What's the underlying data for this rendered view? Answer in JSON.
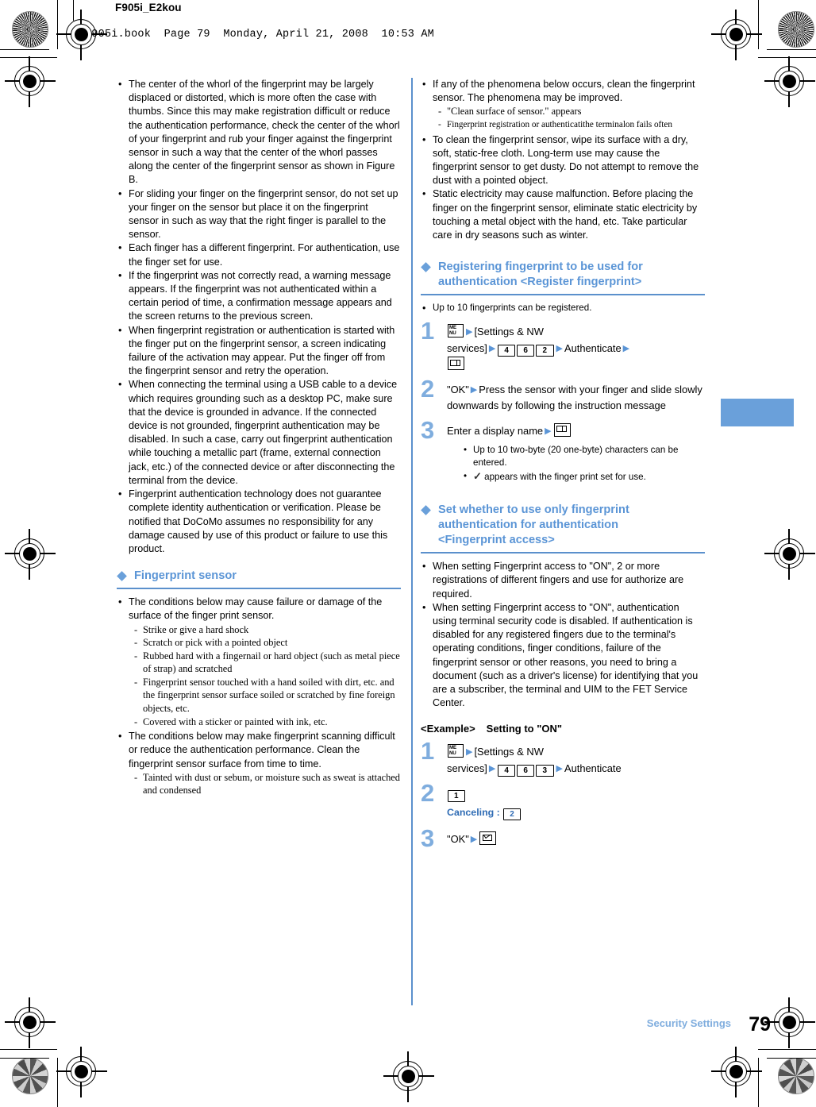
{
  "header": {
    "doc_code": "F905i_E2kou",
    "book_line": "F905i.book  Page 79  Monday, April 21, 2008  10:53 AM"
  },
  "footer": {
    "section_label": "Security Settings",
    "page_number": "79"
  },
  "colors": {
    "accent_blue": "#5b95d6",
    "rule_blue": "#5b90cc",
    "step_number_blue": "#7fadde",
    "tab_blue": "#6aa0da"
  },
  "left_column": {
    "notes": [
      "The center of the whorl of the fingerprint may be largely displaced or distorted, which is more often the case with thumbs. Since this may make registration difficult or reduce the authentication performance, check the center of the whorl of your fingerprint and rub your finger against the fingerprint sensor in such a way that the center of the whorl passes along the center of the fingerprint sensor as shown in Figure B.",
      "For sliding your finger on the fingerprint sensor, do not set up your finger on the sensor but place it on the fingerprint sensor in such as way that the right finger is parallel to the sensor.",
      "Each finger has a different fingerprint. For authentication, use the finger set for use.",
      "If the fingerprint was not correctly read, a warning message appears. If the fingerprint was not authenticated within a certain period of time, a confirmation message appears and the screen returns to the previous screen.",
      "When fingerprint registration or authentication is started with the finger put on the fingerprint sensor, a screen indicating failure of the activation may appear. Put the finger off from the fingerprint sensor and retry the operation.",
      "When connecting the terminal using a USB cable to a device which requires grounding such as a desktop PC, make sure that the device is grounded in advance. If the connected device is not grounded, fingerprint authentication may be disabled. In such a case, carry out fingerprint authentication while touching a metallic part (frame, external connection jack, etc.) of the connected device or after disconnecting the terminal from the device.",
      "Fingerprint authentication technology does not guarantee complete identity authentication or verification. Please be notified that DoCoMo assumes no responsibility for any damage caused by use of this product or failure to use this product."
    ],
    "sensor_section": {
      "heading": "Fingerprint sensor",
      "note1": "The conditions below may cause failure or damage of the surface of the finger print sensor.",
      "note1_items": [
        "Strike or give a hard shock",
        "Scratch or pick with a pointed object",
        "Rubbed hard with a fingernail or hard object (such as metal piece of strap) and scratched",
        "Fingerprint sensor touched with a hand soiled with dirt, etc. and the fingerprint sensor surface soiled or scratched by fine foreign objects, etc.",
        "Covered with a sticker or painted with ink, etc."
      ],
      "note2": "The conditions below may make fingerprint scanning difficult or reduce the authentication performance. Clean the fingerprint sensor surface from time to time.",
      "note2_items": [
        "Tainted with dust or sebum, or moisture such as sweat is attached and condensed"
      ]
    }
  },
  "right_column": {
    "notes_top": {
      "note1": "If any of the phenomena below occurs, clean the fingerprint sensor. The phenomena may be improved.",
      "note1_items": [
        "\"Clean surface of sensor.\" appears",
        "Fingerprint registration or authenticatithe terminalon fails often"
      ],
      "note2": "To clean the fingerprint sensor, wipe its surface with a dry, soft, static-free cloth. Long-term use may cause the fingerprint sensor to get dusty. Do not attempt to remove the dust with a pointed object.",
      "note3": "Static electricity may cause malfunction. Before placing the finger on the fingerprint sensor, eliminate static electricity by touching a metal object with the hand, etc. Take particular care in dry seasons such as winter."
    },
    "register_section": {
      "heading_line1": "Registering fingerprint to be used for",
      "heading_line2": "authentication <Register fingerprint>",
      "intro_note": "Up to 10 fingerprints can be registered.",
      "step1": {
        "num": "1",
        "menu_key": "MENU",
        "menu_top": "ME",
        "menu_bottom": "NU",
        "label_settings": "[Settings & NW",
        "label_settings2": "services]",
        "keys": [
          "4",
          "6",
          "2"
        ],
        "authenticate": "Authenticate",
        "end_key": "book-key"
      },
      "step2": {
        "num": "2",
        "text": "\"OK\"",
        "text2": "Press the sensor with your finger and slide slowly downwards by following the instruction message"
      },
      "step3": {
        "num": "3",
        "text": "Enter a display name",
        "end_key": "book-key",
        "subnotes": [
          "Up to 10 two-byte (20 one-byte) characters can be entered.",
          "appears with the finger print set for use."
        ],
        "check_glyph": "✓"
      }
    },
    "access_section": {
      "heading_line1": "Set whether to use only fingerprint",
      "heading_line2": "authentication for authentication",
      "heading_line3": "<Fingerprint access>",
      "notes": [
        "When setting Fingerprint access to \"ON\", 2 or more registrations of different fingers and use for authorize are required.",
        "When setting Fingerprint access to \"ON\", authentication using terminal security code is disabled. If authentication is disabled for any registered fingers due to the terminal's operating conditions, finger conditions, failure of the fingerprint sensor or other reasons, you need to bring a document (such as a driver's license) for identifying that you are a subscriber, the terminal and UIM to the FET Service Center."
      ],
      "example": {
        "label": "<Example>",
        "title": "Setting to \"ON\""
      },
      "step1": {
        "num": "1",
        "menu_top": "ME",
        "menu_bottom": "NU",
        "label_settings": "[Settings & NW",
        "label_settings2": "services]",
        "keys": [
          "4",
          "6",
          "3"
        ],
        "authenticate": "Authenticate"
      },
      "step2": {
        "num": "2",
        "key": "1",
        "cancel_label": "Canceling :",
        "cancel_key": "2"
      },
      "step3": {
        "num": "3",
        "text": "\"OK\"",
        "end_key": "mail-key"
      }
    }
  }
}
